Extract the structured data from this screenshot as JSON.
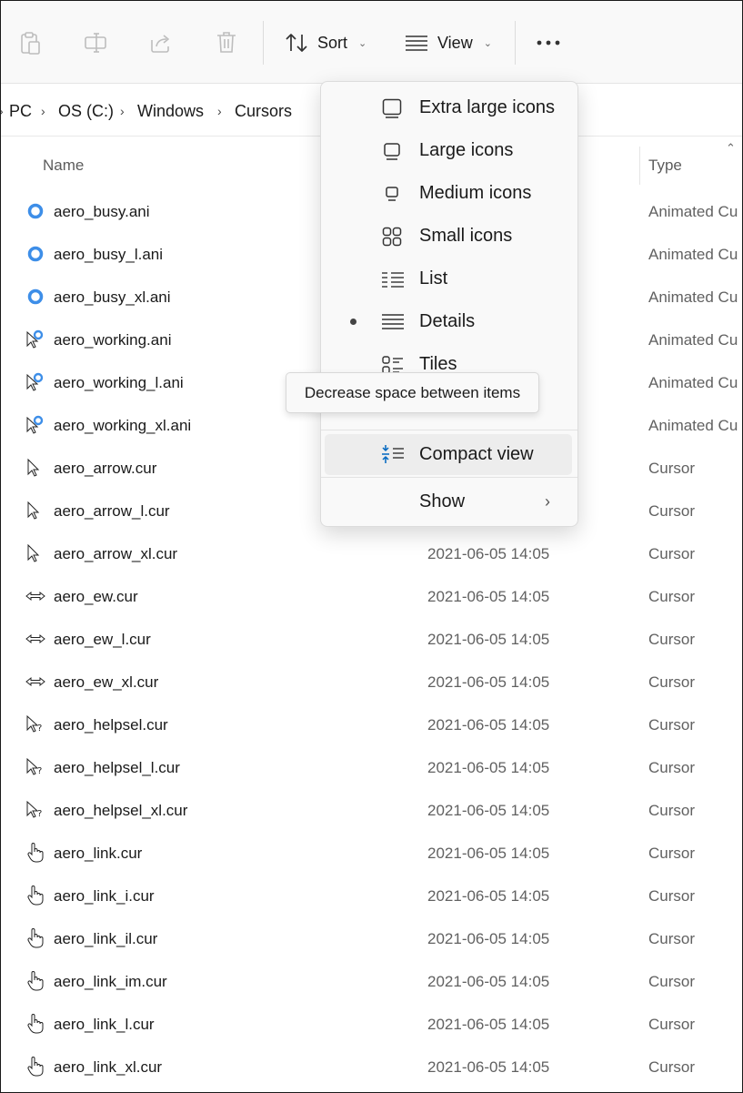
{
  "toolbar": {
    "sort_label": "Sort",
    "view_label": "View",
    "icons": [
      "paste-icon",
      "rename-icon",
      "share-icon",
      "delete-icon",
      "sort-icon",
      "view-icon",
      "more-icon"
    ]
  },
  "breadcrumb": [
    "PC",
    "OS (C:)",
    "Windows",
    "Cursors"
  ],
  "columns": {
    "name": "Name",
    "type": "Type"
  },
  "files": [
    {
      "name": "aero_busy.ani",
      "date": "",
      "type": "Animated Cu",
      "icon": "busy-ring-icon"
    },
    {
      "name": "aero_busy_l.ani",
      "date": "",
      "type": "Animated Cu",
      "icon": "busy-ring-icon"
    },
    {
      "name": "aero_busy_xl.ani",
      "date": "",
      "type": "Animated Cu",
      "icon": "busy-ring-icon"
    },
    {
      "name": "aero_working.ani",
      "date": "",
      "type": "Animated Cu",
      "icon": "working-cursor-icon"
    },
    {
      "name": "aero_working_l.ani",
      "date": "",
      "type": "Animated Cu",
      "icon": "working-cursor-icon"
    },
    {
      "name": "aero_working_xl.ani",
      "date": "",
      "type": "Animated Cu",
      "icon": "working-cursor-icon"
    },
    {
      "name": "aero_arrow.cur",
      "date": "",
      "type": "Cursor",
      "icon": "arrow-cursor-icon"
    },
    {
      "name": "aero_arrow_l.cur",
      "date": "",
      "type": "Cursor",
      "icon": "arrow-cursor-icon"
    },
    {
      "name": "aero_arrow_xl.cur",
      "date": "2021-06-05 14:05",
      "type": "Cursor",
      "icon": "arrow-cursor-icon"
    },
    {
      "name": "aero_ew.cur",
      "date": "2021-06-05 14:05",
      "type": "Cursor",
      "icon": "resize-ew-icon"
    },
    {
      "name": "aero_ew_l.cur",
      "date": "2021-06-05 14:05",
      "type": "Cursor",
      "icon": "resize-ew-icon"
    },
    {
      "name": "aero_ew_xl.cur",
      "date": "2021-06-05 14:05",
      "type": "Cursor",
      "icon": "resize-ew-icon"
    },
    {
      "name": "aero_helpsel.cur",
      "date": "2021-06-05 14:05",
      "type": "Cursor",
      "icon": "help-cursor-icon"
    },
    {
      "name": "aero_helpsel_l.cur",
      "date": "2021-06-05 14:05",
      "type": "Cursor",
      "icon": "help-cursor-icon"
    },
    {
      "name": "aero_helpsel_xl.cur",
      "date": "2021-06-05 14:05",
      "type": "Cursor",
      "icon": "help-cursor-icon"
    },
    {
      "name": "aero_link.cur",
      "date": "2021-06-05 14:05",
      "type": "Cursor",
      "icon": "hand-cursor-icon"
    },
    {
      "name": "aero_link_i.cur",
      "date": "2021-06-05 14:05",
      "type": "Cursor",
      "icon": "hand-cursor-icon"
    },
    {
      "name": "aero_link_il.cur",
      "date": "2021-06-05 14:05",
      "type": "Cursor",
      "icon": "hand-cursor-icon"
    },
    {
      "name": "aero_link_im.cur",
      "date": "2021-06-05 14:05",
      "type": "Cursor",
      "icon": "hand-cursor-icon"
    },
    {
      "name": "aero_link_l.cur",
      "date": "2021-06-05 14:05",
      "type": "Cursor",
      "icon": "hand-cursor-icon"
    },
    {
      "name": "aero_link_xl.cur",
      "date": "2021-06-05 14:05",
      "type": "Cursor",
      "icon": "hand-cursor-icon"
    }
  ],
  "view_menu": {
    "items": [
      {
        "label": "Extra large icons",
        "icon": "extra-large-icons-icon"
      },
      {
        "label": "Large icons",
        "icon": "large-icons-icon"
      },
      {
        "label": "Medium icons",
        "icon": "medium-icons-icon"
      },
      {
        "label": "Small icons",
        "icon": "small-icons-icon"
      },
      {
        "label": "List",
        "icon": "list-icon"
      },
      {
        "label": "Details",
        "icon": "details-icon",
        "selected": true
      },
      {
        "label": "Tiles",
        "icon": "tiles-icon"
      }
    ],
    "compact_view": "Compact view",
    "show": "Show"
  },
  "tooltip": "Decrease space between items",
  "colors": {
    "accent": "#0067c0",
    "busy_ring": "#3d8ee8"
  }
}
